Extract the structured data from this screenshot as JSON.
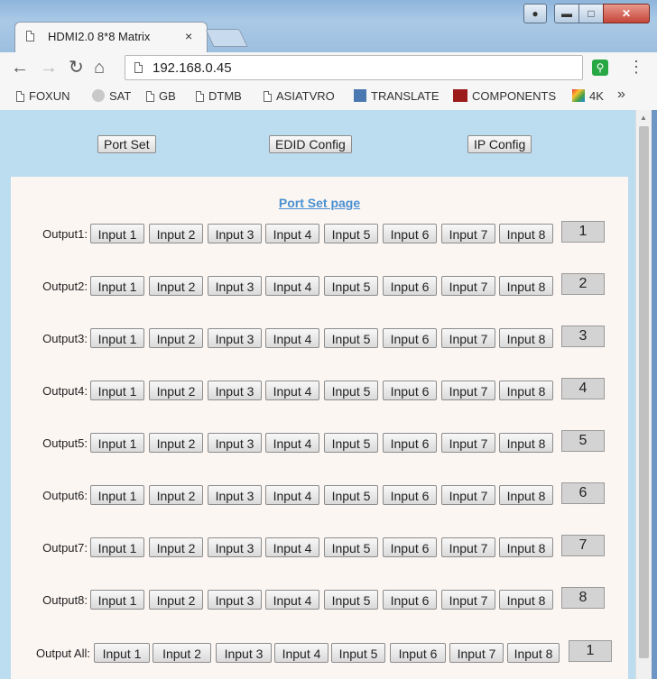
{
  "browser": {
    "tab_title": "HDMI2.0 8*8 Matrix",
    "tab_close": "×",
    "url": "192.168.0.45",
    "bookmarks": [
      "FOXUN",
      "SAT",
      "GB",
      "DTMB",
      "ASIATVRO",
      "TRANSLATE",
      "COMPONENTS",
      "4K"
    ],
    "more": "»"
  },
  "nav": {
    "port_set": "Port Set",
    "edid_config": "EDID Config",
    "ip_config": "IP Config"
  },
  "page": {
    "link": "Port Set page",
    "inputs": [
      "Input 1",
      "Input 2",
      "Input 3",
      "Input 4",
      "Input 5",
      "Input 6",
      "Input 7",
      "Input 8"
    ],
    "outputs": [
      {
        "label": "Output1:",
        "selected": "1"
      },
      {
        "label": "Output2:",
        "selected": "2"
      },
      {
        "label": "Output3:",
        "selected": "3"
      },
      {
        "label": "Output4:",
        "selected": "4"
      },
      {
        "label": "Output5:",
        "selected": "5"
      },
      {
        "label": "Output6:",
        "selected": "6"
      },
      {
        "label": "Output7:",
        "selected": "7"
      },
      {
        "label": "Output8:",
        "selected": "8"
      }
    ],
    "output_all": {
      "label": "Output All:",
      "selected": "1"
    }
  }
}
